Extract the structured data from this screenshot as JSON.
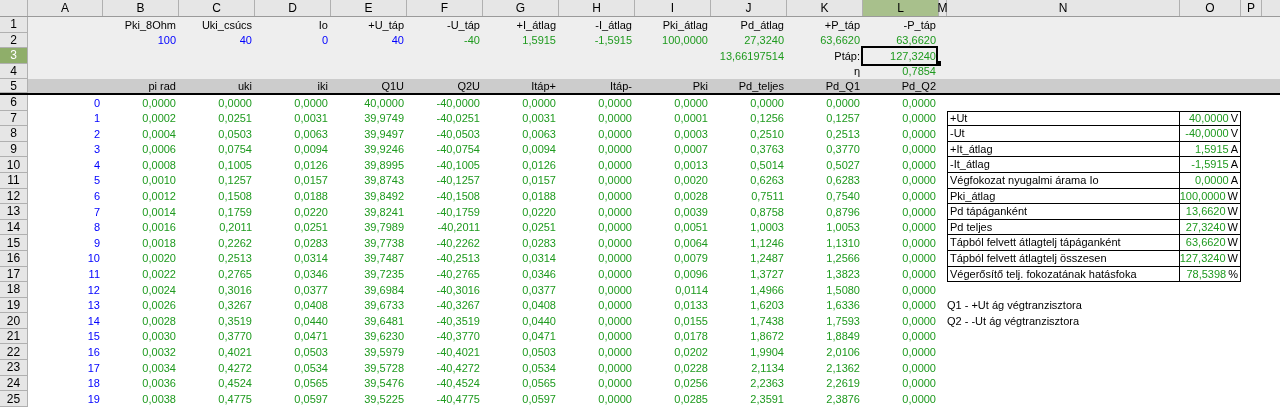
{
  "columns": [
    {
      "label": "A",
      "selected": false
    },
    {
      "label": "B",
      "selected": false
    },
    {
      "label": "C",
      "selected": false
    },
    {
      "label": "D",
      "selected": false
    },
    {
      "label": "E",
      "selected": false
    },
    {
      "label": "F",
      "selected": false
    },
    {
      "label": "G",
      "selected": false
    },
    {
      "label": "H",
      "selected": false
    },
    {
      "label": "I",
      "selected": false
    },
    {
      "label": "J",
      "selected": false
    },
    {
      "label": "K",
      "selected": false
    },
    {
      "label": "L",
      "selected": true
    },
    {
      "label": "M",
      "selected": false
    },
    {
      "label": "N",
      "selected": false
    },
    {
      "label": "O",
      "selected": false
    },
    {
      "label": "P",
      "selected": false
    }
  ],
  "rows": [
    {
      "number": "1",
      "selected": false,
      "kind": "param",
      "cells": [
        null,
        {
          "text": "Pki_8Ohm",
          "kind": "label"
        },
        {
          "text": "Uki_csúcs",
          "kind": "label"
        },
        {
          "text": "Io",
          "kind": "label"
        },
        {
          "text": "+U_táp",
          "kind": "label"
        },
        {
          "text": "-U_táp",
          "kind": "label"
        },
        {
          "text": "+I_átlag",
          "kind": "label"
        },
        {
          "text": "-I_átlag",
          "kind": "label"
        },
        {
          "text": "Pki_átlag",
          "kind": "label"
        },
        {
          "text": "Pd_átlag",
          "kind": "label"
        },
        {
          "text": "+P_táp",
          "kind": "label"
        },
        {
          "text": "-P_táp",
          "kind": "label"
        }
      ]
    },
    {
      "number": "2",
      "selected": false,
      "kind": "param",
      "cells": [
        null,
        {
          "text": "100",
          "kind": "input"
        },
        {
          "text": "40",
          "kind": "input"
        },
        {
          "text": "0",
          "kind": "input"
        },
        {
          "text": "40",
          "kind": "input"
        },
        {
          "text": "-40",
          "kind": "formula"
        },
        {
          "text": "1,5915",
          "kind": "formula"
        },
        {
          "text": "-1,5915",
          "kind": "formula"
        },
        {
          "text": "100,0000",
          "kind": "formula"
        },
        {
          "text": "27,3240",
          "kind": "formula"
        },
        {
          "text": "63,6620",
          "kind": "formula"
        },
        {
          "text": "63,6620",
          "kind": "formula"
        }
      ]
    },
    {
      "number": "3",
      "selected": true,
      "kind": "param",
      "cells": [
        null,
        null,
        null,
        null,
        null,
        null,
        null,
        null,
        null,
        {
          "text": "13,66197514",
          "kind": "formula"
        },
        {
          "text": "Ptáp:",
          "kind": "label"
        },
        {
          "text": "127,3240",
          "kind": "formula"
        }
      ]
    },
    {
      "number": "4",
      "selected": false,
      "kind": "param",
      "cells": [
        null,
        null,
        null,
        null,
        null,
        null,
        null,
        null,
        null,
        null,
        {
          "text": "η",
          "kind": "label"
        },
        {
          "text": "0,7854",
          "kind": "formula"
        }
      ]
    },
    {
      "number": "5",
      "selected": false,
      "kind": "header",
      "cells": [
        null,
        {
          "text": "pi rad",
          "kind": "label"
        },
        {
          "text": "uki",
          "kind": "label"
        },
        {
          "text": "iki",
          "kind": "label"
        },
        {
          "text": "Q1U",
          "kind": "label"
        },
        {
          "text": "Q2U",
          "kind": "label"
        },
        {
          "text": "Itáp+",
          "kind": "label"
        },
        {
          "text": "Itáp-",
          "kind": "label"
        },
        {
          "text": "Pki",
          "kind": "label"
        },
        {
          "text": "Pd_teljes",
          "kind": "label"
        },
        {
          "text": "Pd_Q1",
          "kind": "label"
        },
        {
          "text": "Pd_Q2",
          "kind": "label"
        }
      ]
    },
    {
      "number": "6",
      "selected": false,
      "kind": "data",
      "index": "0",
      "values": [
        "0,0000",
        "0,0000",
        "0,0000",
        "40,0000",
        "-40,0000",
        "0,0000",
        "0,0000",
        "0,0000",
        "0,0000",
        "0,0000",
        "0,0000"
      ]
    },
    {
      "number": "7",
      "selected": false,
      "kind": "data",
      "index": "1",
      "values": [
        "0,0002",
        "0,0251",
        "0,0031",
        "39,9749",
        "-40,0251",
        "0,0031",
        "0,0000",
        "0,0001",
        "0,1256",
        "0,1257",
        "0,0000"
      ],
      "side": {
        "kind": "table",
        "label": "+Ut",
        "value": "40,0000",
        "unit": "V"
      }
    },
    {
      "number": "8",
      "selected": false,
      "kind": "data",
      "index": "2",
      "values": [
        "0,0004",
        "0,0503",
        "0,0063",
        "39,9497",
        "-40,0503",
        "0,0063",
        "0,0000",
        "0,0003",
        "0,2510",
        "0,2513",
        "0,0000"
      ],
      "side": {
        "kind": "table",
        "label": "-Ut",
        "value": "-40,0000",
        "unit": "V"
      }
    },
    {
      "number": "9",
      "selected": false,
      "kind": "data",
      "index": "3",
      "values": [
        "0,0006",
        "0,0754",
        "0,0094",
        "39,9246",
        "-40,0754",
        "0,0094",
        "0,0000",
        "0,0007",
        "0,3763",
        "0,3770",
        "0,0000"
      ],
      "side": {
        "kind": "table",
        "label": "+It_átlag",
        "value": "1,5915",
        "unit": "A"
      }
    },
    {
      "number": "10",
      "selected": false,
      "kind": "data",
      "index": "4",
      "values": [
        "0,0008",
        "0,1005",
        "0,0126",
        "39,8995",
        "-40,1005",
        "0,0126",
        "0,0000",
        "0,0013",
        "0,5014",
        "0,5027",
        "0,0000"
      ],
      "side": {
        "kind": "table",
        "label": "-It_átlag",
        "value": "-1,5915",
        "unit": "A"
      }
    },
    {
      "number": "11",
      "selected": false,
      "kind": "data",
      "index": "5",
      "values": [
        "0,0010",
        "0,1257",
        "0,0157",
        "39,8743",
        "-40,1257",
        "0,0157",
        "0,0000",
        "0,0020",
        "0,6263",
        "0,6283",
        "0,0000"
      ],
      "side": {
        "kind": "table",
        "label": "Végfokozat nyugalmi árama Io",
        "value": "0,0000",
        "unit": "A"
      }
    },
    {
      "number": "12",
      "selected": false,
      "kind": "data",
      "index": "6",
      "values": [
        "0,0012",
        "0,1508",
        "0,0188",
        "39,8492",
        "-40,1508",
        "0,0188",
        "0,0000",
        "0,0028",
        "0,7511",
        "0,7540",
        "0,0000"
      ],
      "side": {
        "kind": "table",
        "label": "Pki_átlag",
        "value": "100,0000",
        "unit": "W"
      }
    },
    {
      "number": "13",
      "selected": false,
      "kind": "data",
      "index": "7",
      "values": [
        "0,0014",
        "0,1759",
        "0,0220",
        "39,8241",
        "-40,1759",
        "0,0220",
        "0,0000",
        "0,0039",
        "0,8758",
        "0,8796",
        "0,0000"
      ],
      "side": {
        "kind": "table",
        "label": "Pd tápáganként",
        "value": "13,6620",
        "unit": "W"
      }
    },
    {
      "number": "14",
      "selected": false,
      "kind": "data",
      "index": "8",
      "values": [
        "0,0016",
        "0,2011",
        "0,0251",
        "39,7989",
        "-40,2011",
        "0,0251",
        "0,0000",
        "0,0051",
        "1,0003",
        "1,0053",
        "0,0000"
      ],
      "side": {
        "kind": "table",
        "label": "Pd teljes",
        "value": "27,3240",
        "unit": "W"
      }
    },
    {
      "number": "15",
      "selected": false,
      "kind": "data",
      "index": "9",
      "values": [
        "0,0018",
        "0,2262",
        "0,0283",
        "39,7738",
        "-40,2262",
        "0,0283",
        "0,0000",
        "0,0064",
        "1,1246",
        "1,1310",
        "0,0000"
      ],
      "side": {
        "kind": "table",
        "label": "Tápból felvett átlagtelj tápáganként",
        "value": "63,6620",
        "unit": "W"
      }
    },
    {
      "number": "16",
      "selected": false,
      "kind": "data",
      "index": "10",
      "values": [
        "0,0020",
        "0,2513",
        "0,0314",
        "39,7487",
        "-40,2513",
        "0,0314",
        "0,0000",
        "0,0079",
        "1,2487",
        "1,2566",
        "0,0000"
      ],
      "side": {
        "kind": "table",
        "label": "Tápból felvett átlagtelj összesen",
        "value": "127,3240",
        "unit": "W"
      }
    },
    {
      "number": "17",
      "selected": false,
      "kind": "data",
      "index": "11",
      "values": [
        "0,0022",
        "0,2765",
        "0,0346",
        "39,7235",
        "-40,2765",
        "0,0346",
        "0,0000",
        "0,0096",
        "1,3727",
        "1,3823",
        "0,0000"
      ],
      "side": {
        "kind": "table",
        "label": "Végerősítő telj. fokozatának hatásfoka",
        "value": "78,5398",
        "unit": "%"
      }
    },
    {
      "number": "18",
      "selected": false,
      "kind": "data",
      "index": "12",
      "values": [
        "0,0024",
        "0,3016",
        "0,0377",
        "39,6984",
        "-40,3016",
        "0,0377",
        "0,0000",
        "0,0114",
        "1,4966",
        "1,5080",
        "0,0000"
      ]
    },
    {
      "number": "19",
      "selected": false,
      "kind": "data",
      "index": "13",
      "values": [
        "0,0026",
        "0,3267",
        "0,0408",
        "39,6733",
        "-40,3267",
        "0,0408",
        "0,0000",
        "0,0133",
        "1,6203",
        "1,6336",
        "0,0000"
      ],
      "side": {
        "kind": "text",
        "text": "Q1 - +Ut ág végtranzisztora"
      }
    },
    {
      "number": "20",
      "selected": false,
      "kind": "data",
      "index": "14",
      "values": [
        "0,0028",
        "0,3519",
        "0,0440",
        "39,6481",
        "-40,3519",
        "0,0440",
        "0,0000",
        "0,0155",
        "1,7438",
        "1,7593",
        "0,0000"
      ],
      "side": {
        "kind": "text",
        "text": "Q2 - -Ut ág végtranzisztora"
      }
    },
    {
      "number": "21",
      "selected": false,
      "kind": "data",
      "index": "15",
      "values": [
        "0,0030",
        "0,3770",
        "0,0471",
        "39,6230",
        "-40,3770",
        "0,0471",
        "0,0000",
        "0,0178",
        "1,8672",
        "1,8849",
        "0,0000"
      ]
    },
    {
      "number": "22",
      "selected": false,
      "kind": "data",
      "index": "16",
      "values": [
        "0,0032",
        "0,4021",
        "0,0503",
        "39,5979",
        "-40,4021",
        "0,0503",
        "0,0000",
        "0,0202",
        "1,9904",
        "2,0106",
        "0,0000"
      ]
    },
    {
      "number": "23",
      "selected": false,
      "kind": "data",
      "index": "17",
      "values": [
        "0,0034",
        "0,4272",
        "0,0534",
        "39,5728",
        "-40,4272",
        "0,0534",
        "0,0000",
        "0,0228",
        "2,1134",
        "2,1362",
        "0,0000"
      ]
    },
    {
      "number": "24",
      "selected": false,
      "kind": "data",
      "index": "18",
      "values": [
        "0,0036",
        "0,4524",
        "0,0565",
        "39,5476",
        "-40,4524",
        "0,0565",
        "0,0000",
        "0,0256",
        "2,2363",
        "2,2619",
        "0,0000"
      ]
    },
    {
      "number": "25",
      "selected": false,
      "kind": "data",
      "index": "19",
      "values": [
        "0,0038",
        "0,4775",
        "0,0597",
        "39,5225",
        "-40,4775",
        "0,0597",
        "0,0000",
        "0,0285",
        "2,3591",
        "2,3876",
        "0,0000"
      ]
    }
  ]
}
